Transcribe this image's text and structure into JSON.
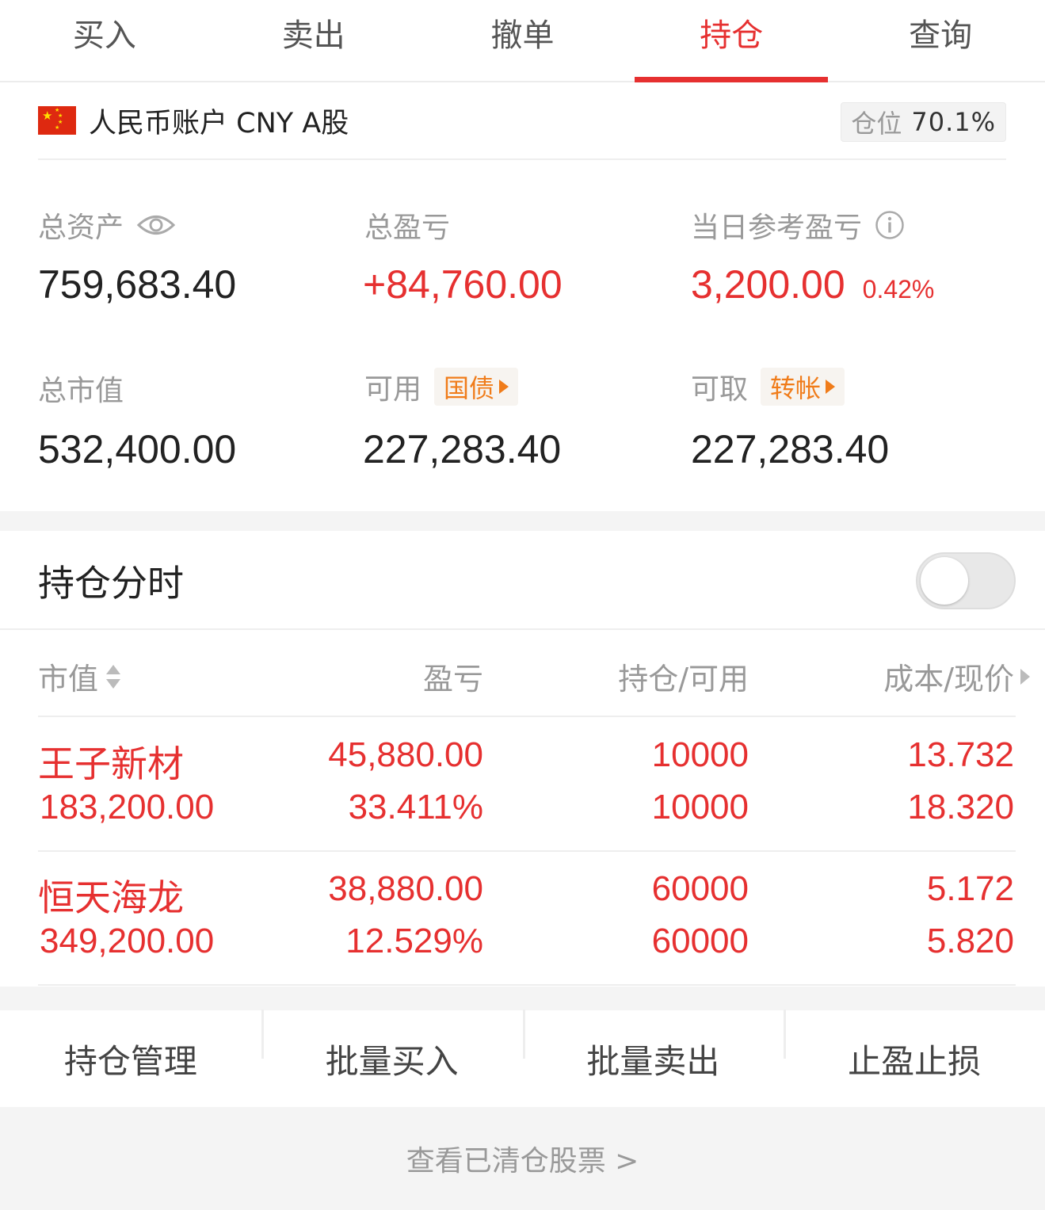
{
  "tabs": [
    {
      "label": "买入"
    },
    {
      "label": "卖出"
    },
    {
      "label": "撤单"
    },
    {
      "label": "持仓"
    },
    {
      "label": "查询"
    }
  ],
  "active_tab": "持仓",
  "account": {
    "name": "人民币账户 CNY A股",
    "position_label": "仓位",
    "position_value": "70.1%"
  },
  "stats": {
    "total_assets": {
      "label": "总资产",
      "value": "759,683.40"
    },
    "total_pnl": {
      "label": "总盈亏",
      "value": "+84,760.00"
    },
    "daily_pnl": {
      "label": "当日参考盈亏",
      "value": "3,200.00",
      "percent": "0.42%"
    },
    "market_value": {
      "label": "总市值",
      "value": "532,400.00"
    },
    "available": {
      "label": "可用",
      "button": "国债",
      "value": "227,283.40"
    },
    "withdrawable": {
      "label": "可取",
      "button": "转帐",
      "value": "227,283.40"
    }
  },
  "timeshare": {
    "title": "持仓分时",
    "enabled": false
  },
  "table": {
    "headers": {
      "market_value": "市值",
      "pnl": "盈亏",
      "holding": "持仓/可用",
      "cost": "成本/现价"
    },
    "rows": [
      {
        "name": "王子新材",
        "market_value": "183,200.00",
        "pnl": "45,880.00",
        "pnl_pct": "33.411%",
        "holding": "10000",
        "available": "10000",
        "cost": "13.732",
        "price": "18.320"
      },
      {
        "name": "恒天海龙",
        "market_value": "349,200.00",
        "pnl": "38,880.00",
        "pnl_pct": "12.529%",
        "holding": "60000",
        "available": "60000",
        "cost": "5.172",
        "price": "5.820"
      }
    ]
  },
  "actions": [
    {
      "label": "持仓管理"
    },
    {
      "label": "批量买入"
    },
    {
      "label": "批量卖出"
    },
    {
      "label": "止盈止损"
    }
  ],
  "footer": {
    "link": "查看已清仓股票 >"
  },
  "colors": {
    "accent_red": "#e63030",
    "orange": "#f07c1a",
    "muted": "#999999"
  }
}
